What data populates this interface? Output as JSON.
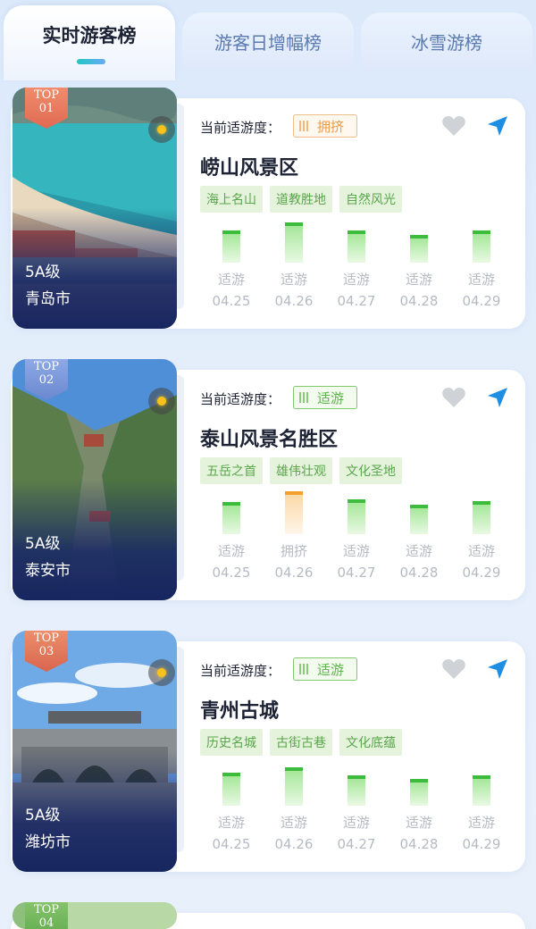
{
  "tabs": [
    {
      "label": "实时游客榜",
      "active": true
    },
    {
      "label": "游客日增幅榜",
      "active": false
    },
    {
      "label": "冰雪游榜",
      "active": false
    }
  ],
  "comfort_prefix": "当前适游度：",
  "colors": {
    "suitable": "#3cbb3c",
    "crowded": "#f2a12c",
    "accent_nav": "#1f8de0"
  },
  "cards": [
    {
      "rank_top": "TOP",
      "rank_num": "01",
      "level": "5A级",
      "city": "青岛市",
      "comfort": "拥挤",
      "name": "崂山风景区",
      "tags": [
        "海上名山",
        "道教胜地",
        "自然风光"
      ],
      "days": [
        {
          "status": "适游",
          "date": "04.25",
          "level": 0.6
        },
        {
          "status": "适游",
          "date": "04.26",
          "level": 0.75
        },
        {
          "status": "适游",
          "date": "04.27",
          "level": 0.6
        },
        {
          "status": "适游",
          "date": "04.28",
          "level": 0.52
        },
        {
          "status": "适游",
          "date": "04.29",
          "level": 0.6
        }
      ]
    },
    {
      "rank_top": "TOP",
      "rank_num": "02",
      "level": "5A级",
      "city": "泰安市",
      "comfort": "适游",
      "name": "泰山风景名胜区",
      "tags": [
        "五岳之首",
        "雄伟壮观",
        "文化圣地"
      ],
      "days": [
        {
          "status": "适游",
          "date": "04.25",
          "level": 0.6
        },
        {
          "status": "拥挤",
          "date": "04.26",
          "level": 0.8
        },
        {
          "status": "适游",
          "date": "04.27",
          "level": 0.65
        },
        {
          "status": "适游",
          "date": "04.28",
          "level": 0.55
        },
        {
          "status": "适游",
          "date": "04.29",
          "level": 0.62
        }
      ]
    },
    {
      "rank_top": "TOP",
      "rank_num": "03",
      "level": "5A级",
      "city": "潍坊市",
      "comfort": "适游",
      "name": "青州古城",
      "tags": [
        "历史名城",
        "古街古巷",
        "文化底蕴"
      ],
      "days": [
        {
          "status": "适游",
          "date": "04.25",
          "level": 0.62
        },
        {
          "status": "适游",
          "date": "04.26",
          "level": 0.72
        },
        {
          "status": "适游",
          "date": "04.27",
          "level": 0.56
        },
        {
          "status": "适游",
          "date": "04.28",
          "level": 0.5
        },
        {
          "status": "适游",
          "date": "04.29",
          "level": 0.56
        }
      ]
    },
    {
      "rank_top": "TOP",
      "rank_num": "04"
    }
  ]
}
